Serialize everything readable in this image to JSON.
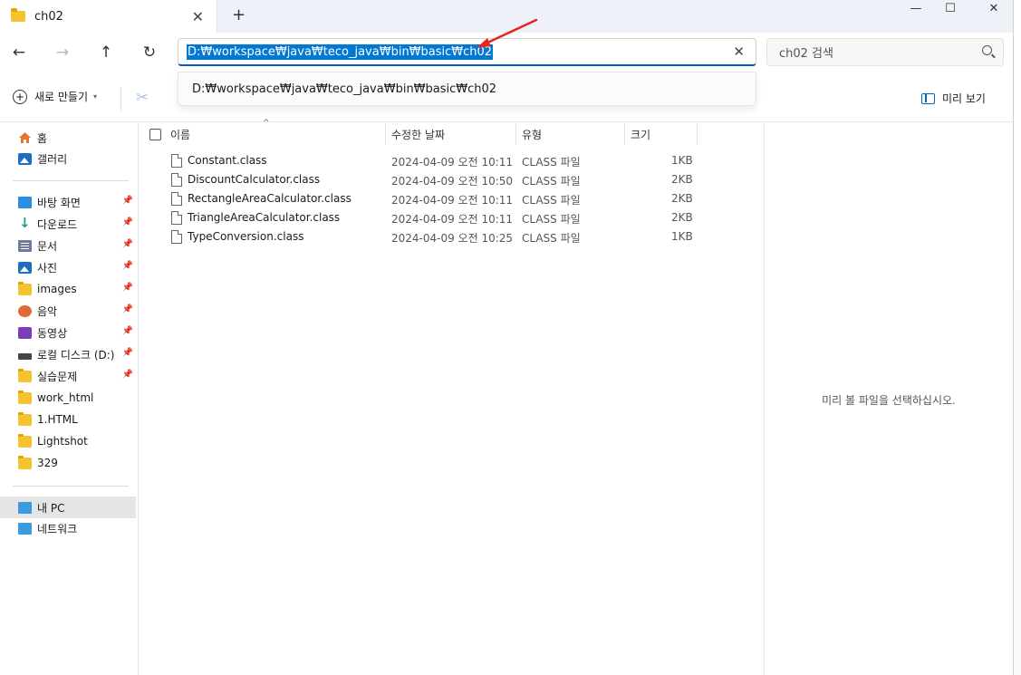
{
  "window": {
    "tab_title": "ch02",
    "new_tab_symbol": "+",
    "close_tab_symbol": "✕",
    "minimize_symbol": "—",
    "maximize_symbol": "☐",
    "close_symbol": "✕"
  },
  "address_bar": {
    "path": "D:₩workspace₩java₩teco_java₩bin₩basic₩ch02",
    "clear_symbol": "✕",
    "suggestion": "D:₩workspace₩java₩teco_java₩bin₩basic₩ch02"
  },
  "search": {
    "placeholder": "ch02 검색"
  },
  "navigation": {
    "back": "←",
    "forward": "→",
    "up": "↑",
    "refresh": "↻"
  },
  "toolbar": {
    "new_label": "새로 만들기",
    "preview_label": "미리 보기"
  },
  "sidebar": {
    "home": "홈",
    "gallery": "갤러리",
    "quick_access": [
      {
        "label": "바탕 화면",
        "icon": "desktop-icon"
      },
      {
        "label": "다운로드",
        "icon": "download-icon"
      },
      {
        "label": "문서",
        "icon": "documents-icon"
      },
      {
        "label": "사진",
        "icon": "pictures-icon"
      },
      {
        "label": "images",
        "icon": "folder-icon"
      },
      {
        "label": "음악",
        "icon": "music-icon"
      },
      {
        "label": "동영상",
        "icon": "video-icon"
      },
      {
        "label": "로컬 디스크 (D:)",
        "icon": "drive-icon"
      },
      {
        "label": "실습문제",
        "icon": "folder-icon"
      },
      {
        "label": "work_html",
        "icon": "folder-icon"
      },
      {
        "label": "1.HTML",
        "icon": "folder-icon"
      },
      {
        "label": "Lightshot",
        "icon": "folder-icon"
      },
      {
        "label": "329",
        "icon": "folder-icon"
      }
    ],
    "this_pc": "내 PC",
    "network": "네트워크"
  },
  "columns": {
    "name": "이름",
    "modified": "수정한 날짜",
    "type": "유형",
    "size": "크기"
  },
  "files": [
    {
      "name": "Constant.class",
      "modified": "2024-04-09 오전 10:11",
      "type": "CLASS 파일",
      "size": "1KB"
    },
    {
      "name": "DiscountCalculator.class",
      "modified": "2024-04-09 오전 10:50",
      "type": "CLASS 파일",
      "size": "2KB"
    },
    {
      "name": "RectangleAreaCalculator.class",
      "modified": "2024-04-09 오전 10:11",
      "type": "CLASS 파일",
      "size": "2KB"
    },
    {
      "name": "TriangleAreaCalculator.class",
      "modified": "2024-04-09 오전 10:11",
      "type": "CLASS 파일",
      "size": "2KB"
    },
    {
      "name": "TypeConversion.class",
      "modified": "2024-04-09 오전 10:25",
      "type": "CLASS 파일",
      "size": "1KB"
    }
  ],
  "preview_pane": {
    "message": "미리 볼 파일을 선택하십시오."
  },
  "colors": {
    "selection": "#0078d4",
    "accent": "#005fb8",
    "annotation_arrow": "#e8241c"
  }
}
